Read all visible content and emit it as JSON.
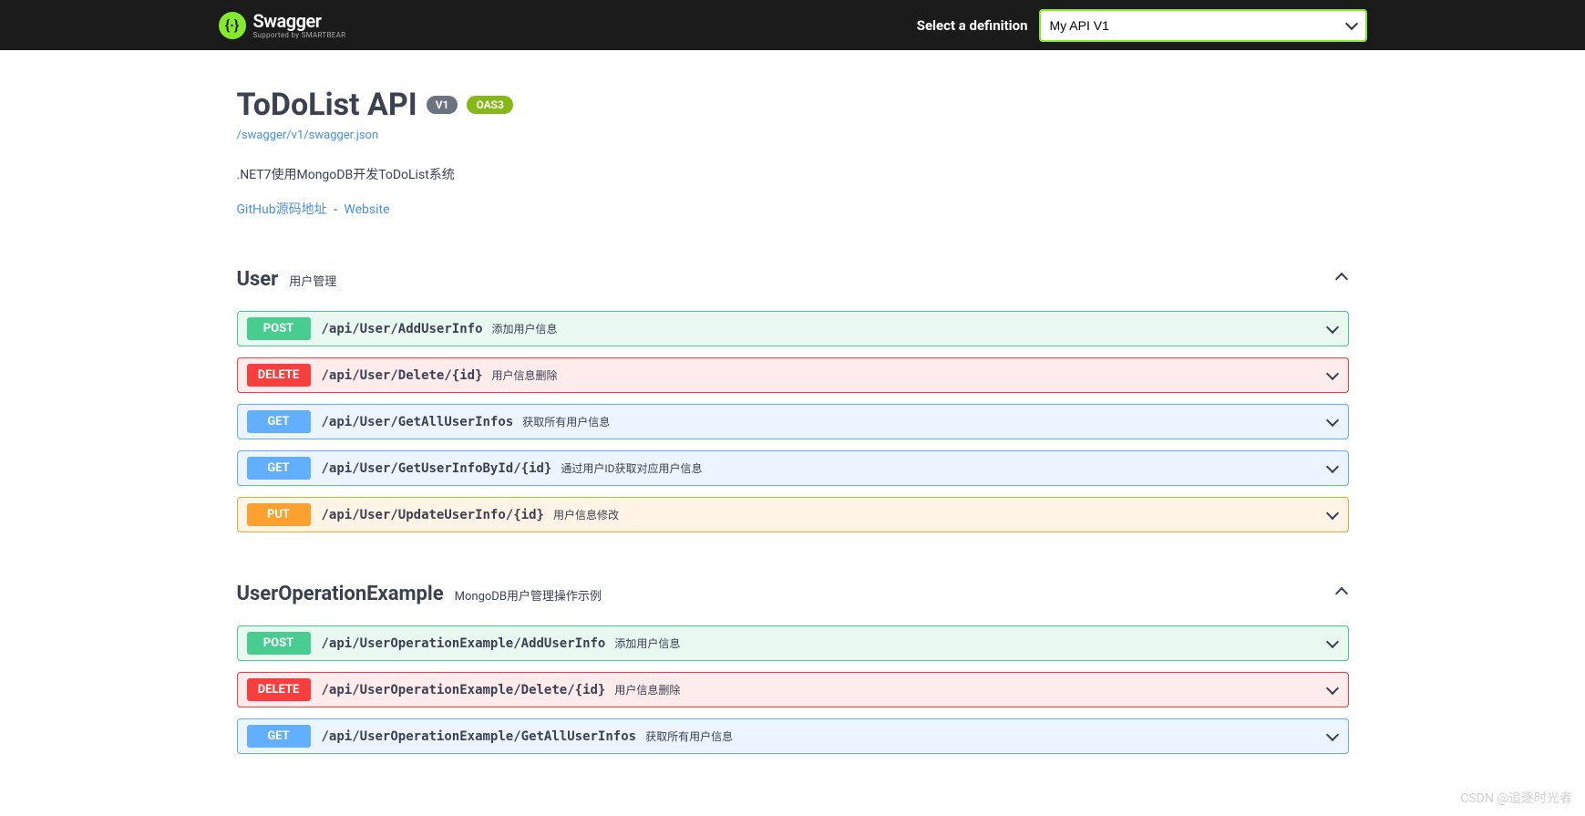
{
  "topbar": {
    "brand_name": "Swagger",
    "brand_sub": "Supported by SMARTBEAR",
    "definition_label": "Select a definition",
    "definition_selected": "My API V1"
  },
  "info": {
    "title": "ToDoList API",
    "version_badge": "V1",
    "oas_badge": "OAS3",
    "spec_url": "/swagger/v1/swagger.json",
    "description": ".NET7使用MongoDB开发ToDoList系统",
    "link1": "GitHub源码地址",
    "link_sep": " - ",
    "link2": "Website"
  },
  "tags": [
    {
      "name": "User",
      "desc": "用户管理",
      "ops": [
        {
          "method": "POST",
          "path": "/api/User/AddUserInfo",
          "summary": "添加用户信息"
        },
        {
          "method": "DELETE",
          "path": "/api/User/Delete/{id}",
          "summary": "用户信息删除"
        },
        {
          "method": "GET",
          "path": "/api/User/GetAllUserInfos",
          "summary": "获取所有用户信息"
        },
        {
          "method": "GET",
          "path": "/api/User/GetUserInfoById/{id}",
          "summary": "通过用户ID获取对应用户信息"
        },
        {
          "method": "PUT",
          "path": "/api/User/UpdateUserInfo/{id}",
          "summary": "用户信息修改"
        }
      ]
    },
    {
      "name": "UserOperationExample",
      "desc": "MongoDB用户管理操作示例",
      "ops": [
        {
          "method": "POST",
          "path": "/api/UserOperationExample/AddUserInfo",
          "summary": "添加用户信息"
        },
        {
          "method": "DELETE",
          "path": "/api/UserOperationExample/Delete/{id}",
          "summary": "用户信息删除"
        },
        {
          "method": "GET",
          "path": "/api/UserOperationExample/GetAllUserInfos",
          "summary": "获取所有用户信息"
        }
      ]
    }
  ],
  "watermark": "CSDN @追逐时光者"
}
